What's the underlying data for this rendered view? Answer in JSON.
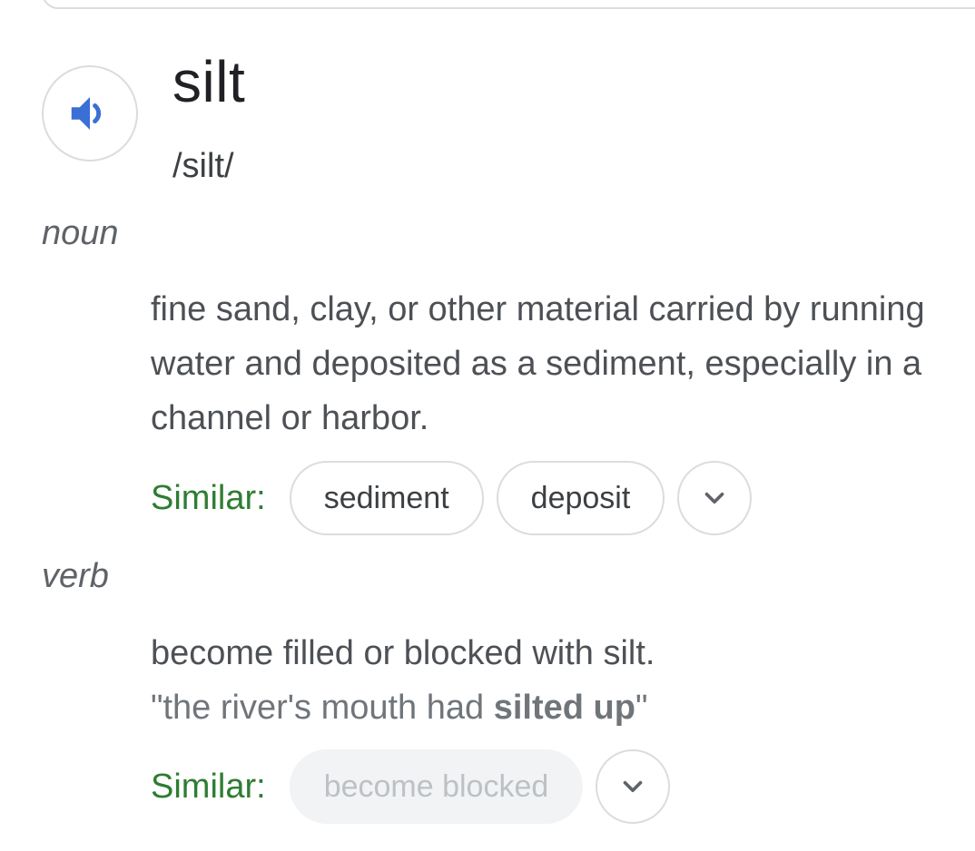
{
  "entry": {
    "word": "silt",
    "pronunciation": "/silt/",
    "speaker_icon": "speaker-volume-icon",
    "accent_color": "#3b6fd6"
  },
  "noun": {
    "part_of_speech": "noun",
    "definition": "fine sand, clay, or other material carried by running water and deposited as a sediment, especially in a channel or harbor.",
    "similar_label": "Similar:",
    "similar": [
      "sediment",
      "deposit"
    ],
    "expand_icon": "chevron-down-icon"
  },
  "verb": {
    "part_of_speech": "verb",
    "definition": "become filled or blocked with silt.",
    "example_prefix": "\"the river's mouth had ",
    "example_bold": "silted up",
    "example_suffix": "\"",
    "similar_label": "Similar:",
    "similar": [
      "become blocked"
    ],
    "expand_icon": "chevron-down-icon"
  },
  "colors": {
    "similar_label": "#2e7d32",
    "chip_border": "#dadce0",
    "disabled_chip_bg": "#f1f3f4"
  }
}
